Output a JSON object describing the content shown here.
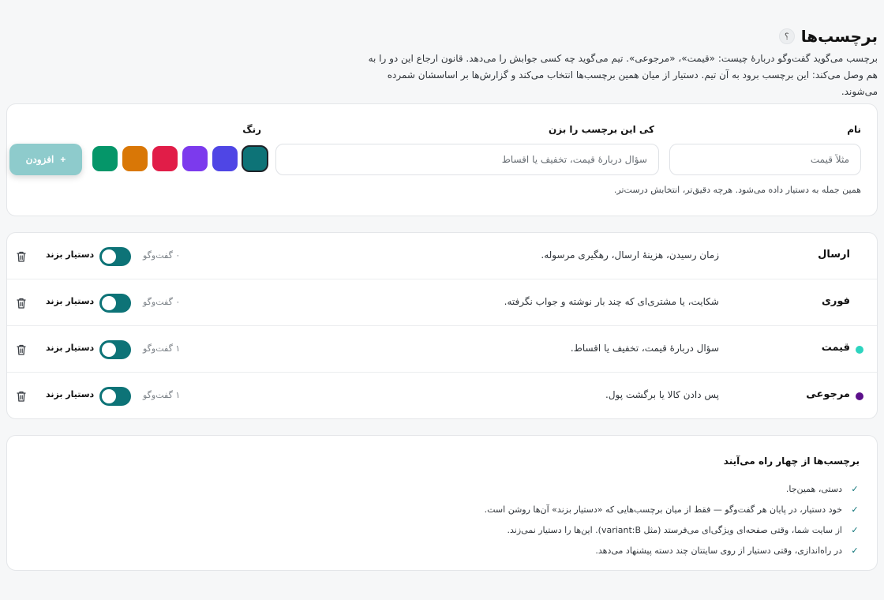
{
  "header": {
    "title": "برچسب‌ها",
    "help": "؟",
    "intro": "برچسب می‌گوید گفت‌وگو دربارهٔ چیست: «قیمت»، «مرجوعی». تیم می‌گوید چه کسی جوابش را می‌دهد. قانون ارجاع این دو را به هم وصل می‌کند: این برچسب برود به آن تیم. دستیار از میان همین برچسب‌ها انتخاب می‌کند و گزارش‌ها بر اساسشان شمرده می‌شوند."
  },
  "form": {
    "name_label": "نام",
    "name_placeholder": "مثلاً قیمت",
    "prompt_label": "کی این برچسب را بزن",
    "prompt_placeholder": "سؤال دربارهٔ قیمت، تخفیف یا اقساط",
    "color_label": "رنگ",
    "add_label": "افزودن",
    "add_icon": "+",
    "hint": "همین جمله به دستیار داده می‌شود. هرچه دقیق‌تر، انتخابش درست‌تر.",
    "colors": [
      "#0d7377",
      "#4f46e5",
      "#7c3aed",
      "#e11d48",
      "#d97706",
      "#059669"
    ],
    "selected_color": "#0d7377"
  },
  "tags": [
    {
      "name": "ارسال",
      "color": "",
      "description": "زمان رسیدن، هزینهٔ ارسال، رهگیری مرسوله.",
      "count": "۰ گفت‌وگو",
      "toggle_label": "دستیار بزند",
      "enabled": true
    },
    {
      "name": "فوری",
      "color": "",
      "description": "شکایت، یا مشتری‌ای که چند بار نوشته و جواب نگرفته.",
      "count": "۰ گفت‌وگو",
      "toggle_label": "دستیار بزند",
      "enabled": true
    },
    {
      "name": "قیمت",
      "color": "#2dd4bf",
      "description": "سؤال دربارهٔ قیمت، تخفیف یا اقساط.",
      "count": "۱ گفت‌وگو",
      "toggle_label": "دستیار بزند",
      "enabled": true
    },
    {
      "name": "مرجوعی",
      "color": "#5b0f8a",
      "description": "پس دادن کالا یا برگشت پول.",
      "count": "۱ گفت‌وگو",
      "toggle_label": "دستیار بزند",
      "enabled": true
    }
  ],
  "info": {
    "title": "برچسب‌ها از چهار راه می‌آیند",
    "items": [
      "دستی، همین‌جا.",
      "خود دستیار، در پایان هر گفت‌وگو — فقط از میان برچسب‌هایی که «دستیار بزند» آن‌ها روشن است.",
      "از سایت شما، وقتی صفحه‌ای ویژگی‌ای می‌فرستد (مثل variant:B). این‌ها را دستیار نمی‌زند.",
      "در راه‌اندازی، وقتی دستیار از روی سایتتان چند دسته پیشنهاد می‌دهد."
    ]
  }
}
